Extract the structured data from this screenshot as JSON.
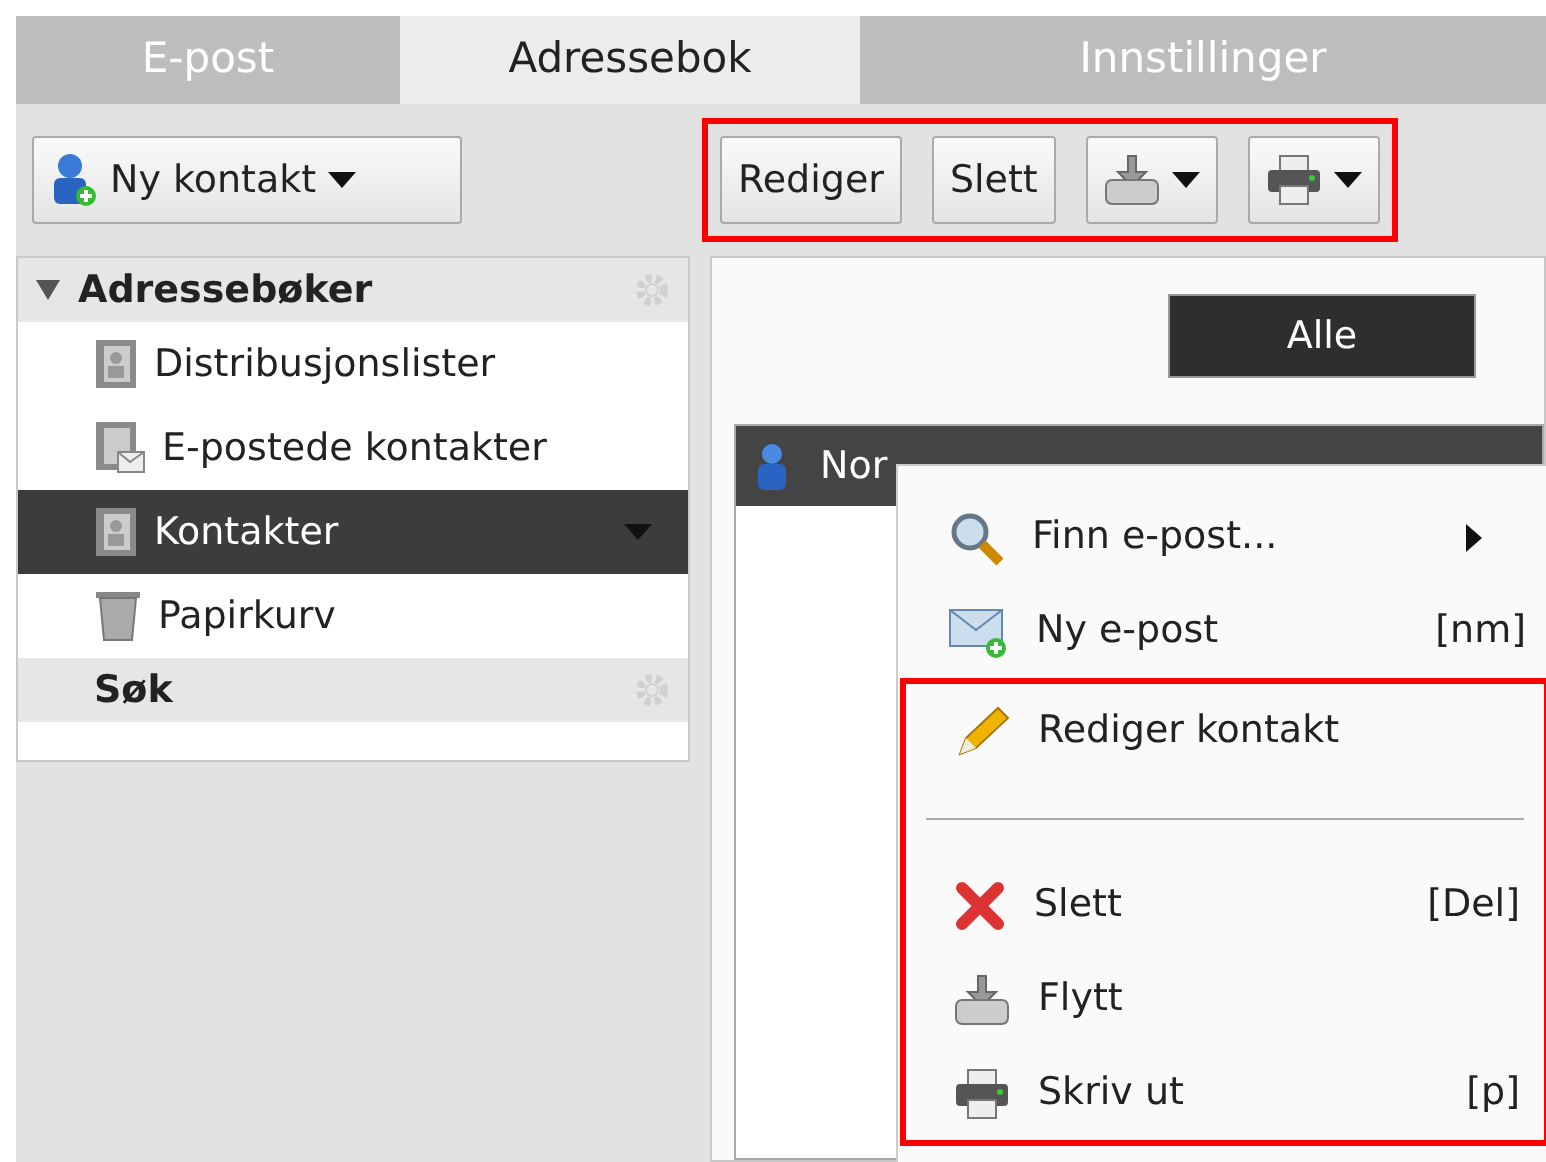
{
  "tabs": [
    {
      "label": "E-post",
      "selected": false
    },
    {
      "label": "Adressebok",
      "selected": true
    },
    {
      "label": "Innstillinger",
      "selected": false
    }
  ],
  "new_contact_button": {
    "label": "Ny kontakt"
  },
  "toolbar": {
    "highlighted": true,
    "buttons": [
      {
        "kind": "text",
        "label": "Rediger"
      },
      {
        "kind": "text",
        "label": "Slett"
      },
      {
        "kind": "move"
      },
      {
        "kind": "print"
      }
    ]
  },
  "sidebar": {
    "sections": [
      {
        "title": "Adressebøker",
        "expanded": true,
        "items": [
          {
            "kind": "book",
            "label": "Distribusjonslister",
            "selected": false
          },
          {
            "kind": "mailbook",
            "label": "E-postede kontakter",
            "selected": false
          },
          {
            "kind": "book",
            "label": "Kontakter",
            "selected": true
          },
          {
            "kind": "trash",
            "label": "Papirkurv",
            "selected": false
          }
        ]
      },
      {
        "title": "Søk",
        "expanded": false
      }
    ]
  },
  "filters": [
    {
      "label": "Alle",
      "selected": true
    }
  ],
  "contacts": [
    {
      "name": "Nor",
      "selected": true
    }
  ],
  "context_menu": {
    "groups": [
      {
        "highlighted": false,
        "items": [
          {
            "kind": "search",
            "label": "Finn e-post...",
            "submenu": true
          },
          {
            "kind": "mail",
            "label": "Ny e-post",
            "shortcut": "[nm]"
          }
        ]
      },
      {
        "highlighted": true,
        "items": [
          {
            "kind": "edit",
            "label": "Rediger kontakt"
          },
          {
            "kind": "separator"
          },
          {
            "kind": "delete",
            "label": "Slett",
            "shortcut": "[Del]"
          },
          {
            "kind": "move",
            "label": "Flytt"
          },
          {
            "kind": "print",
            "label": "Skriv ut",
            "shortcut": "[p]"
          }
        ]
      }
    ]
  }
}
